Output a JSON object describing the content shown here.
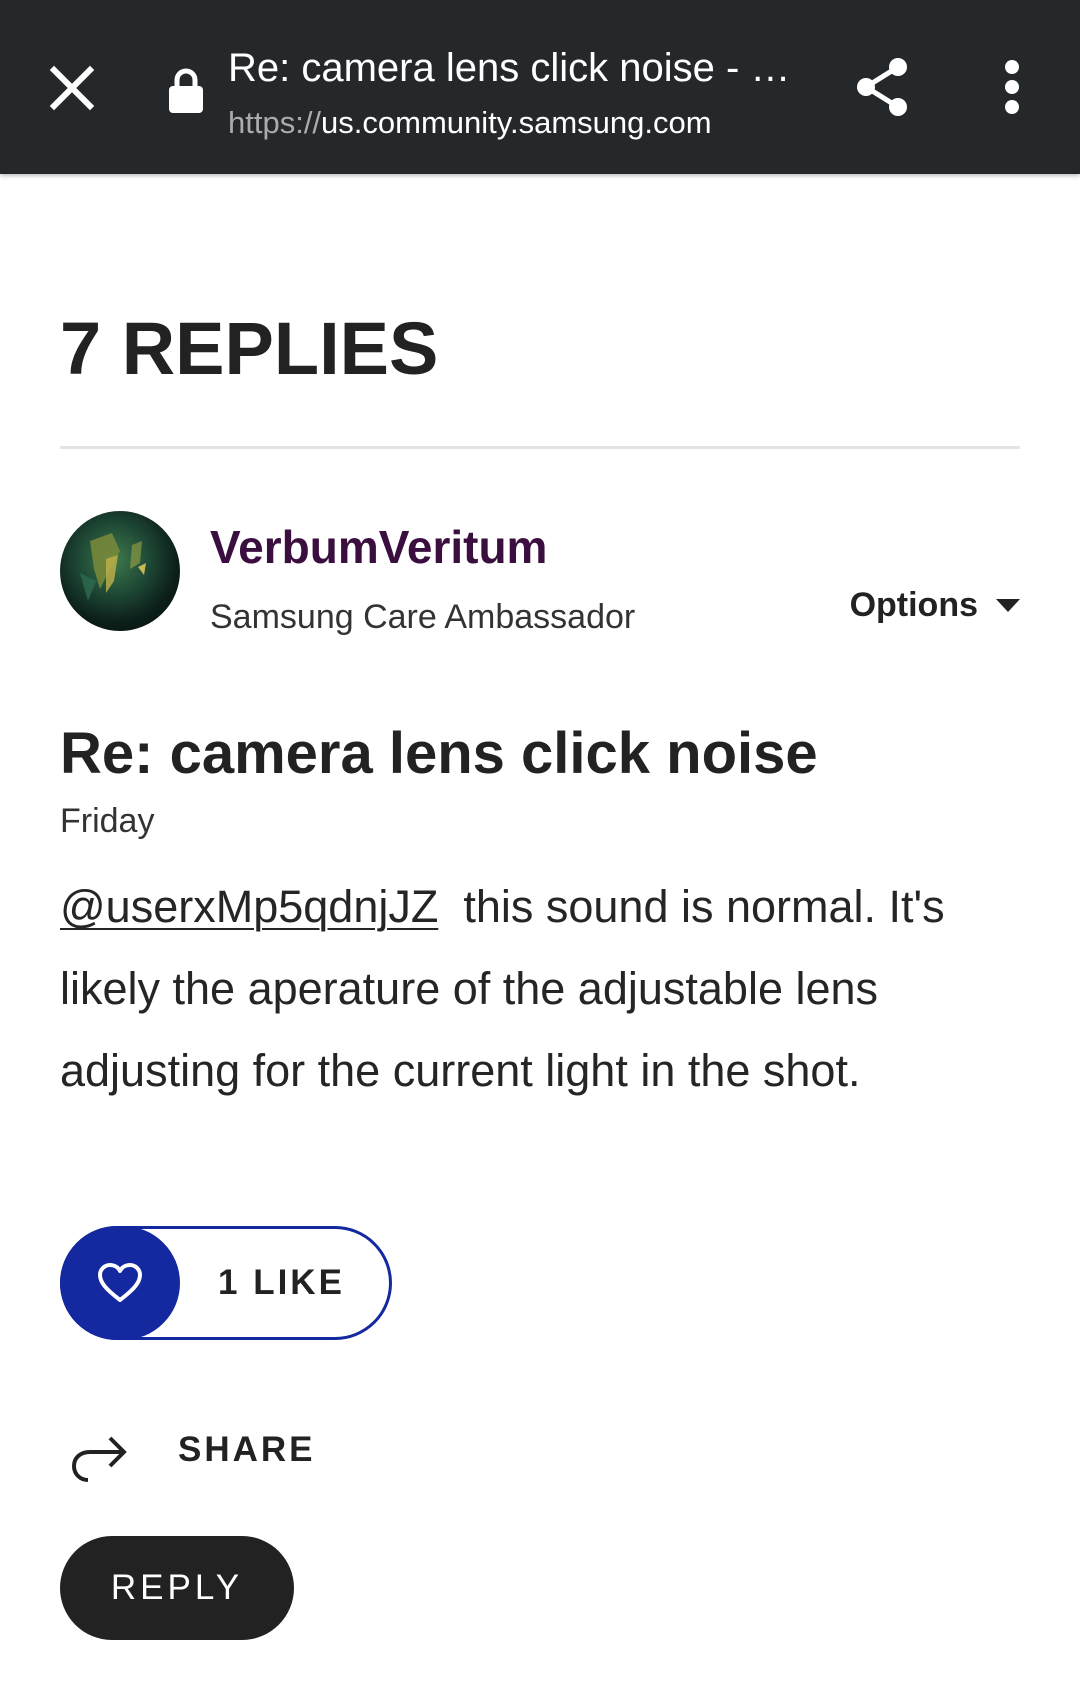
{
  "browser": {
    "title": "Re: camera lens click noise - …",
    "url_scheme": "https://",
    "url_host": "us.community.samsung.com",
    "icons": {
      "close": "close-icon",
      "lock": "lock-icon",
      "share": "share-icon",
      "more": "more-vert-icon"
    },
    "colors": {
      "toolbar_bg": "#25282b",
      "toolbar_text": "#ffffff",
      "scheme_text": "#a9acaf"
    }
  },
  "thread": {
    "replies_heading": "7 REPLIES"
  },
  "post": {
    "author": {
      "name": "VerbumVeritum",
      "rank": "Samsung Care Ambassador",
      "name_color": "#3a0f3f"
    },
    "options_label": "Options",
    "title": "Re: camera lens click noise",
    "date": "Friday",
    "mention": "@userxMp5qdnjJZ",
    "body": "this sound is normal. It's likely the aperature of the adjustable lens adjusting for the current light in the shot.",
    "like_label": "1 LIKE",
    "share_label": "SHARE",
    "reply_label": "REPLY",
    "colors": {
      "like_accent": "#1428a0",
      "reply_bg": "#222222"
    },
    "icons": {
      "like": "heart-icon",
      "share": "share-arrow-icon",
      "options": "caret-down-icon"
    }
  }
}
